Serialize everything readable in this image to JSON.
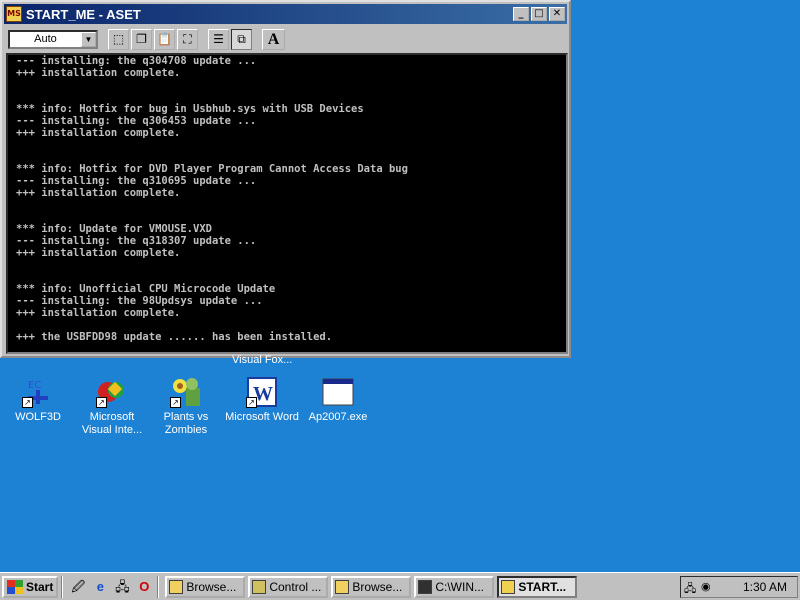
{
  "window": {
    "title": "START_ME - ASET",
    "minimize": "_",
    "maximize": "□",
    "close": "✕",
    "font_select": "Auto"
  },
  "console_lines": [
    "--- installing: the q304708 update ...",
    "+++ installation complete.",
    "",
    "",
    "*** info: Hotfix for bug in Usbhub.sys with USB Devices",
    "--- installing: the q306453 update ...",
    "+++ installation complete.",
    "",
    "",
    "*** info: Hotfix for DVD Player Program Cannot Access Data bug",
    "--- installing: the q310695 update ...",
    "+++ installation complete.",
    "",
    "",
    "*** info: Update for VMOUSE.VXD",
    "--- installing: the q318307 update ...",
    "+++ installation complete.",
    "",
    "",
    "*** info: Unofficial CPU Microcode Update",
    "--- installing: the 98Updsys update ...",
    "+++ installation complete.",
    "",
    "+++ the USBFDD98 update ...... has been installed."
  ],
  "desktop": {
    "hidden_label": "Visual Fox...",
    "icons": [
      {
        "label": "WOLF3D",
        "icon": "wolf3d-icon"
      },
      {
        "label": "Microsoft Visual Inte...",
        "icon": "visual-interdev-icon"
      },
      {
        "label": "Plants vs Zombies",
        "icon": "plants-vs-zombies-icon"
      },
      {
        "label": "Microsoft Word",
        "icon": "word-icon"
      },
      {
        "label": "Ap2007.exe",
        "icon": "exe-window-icon"
      }
    ]
  },
  "taskbar": {
    "start": "Start",
    "tasks": [
      "Browse...",
      "Control ...",
      "Browse...",
      "C:\\WIN...",
      "START..."
    ],
    "clock": "1:30 AM"
  }
}
